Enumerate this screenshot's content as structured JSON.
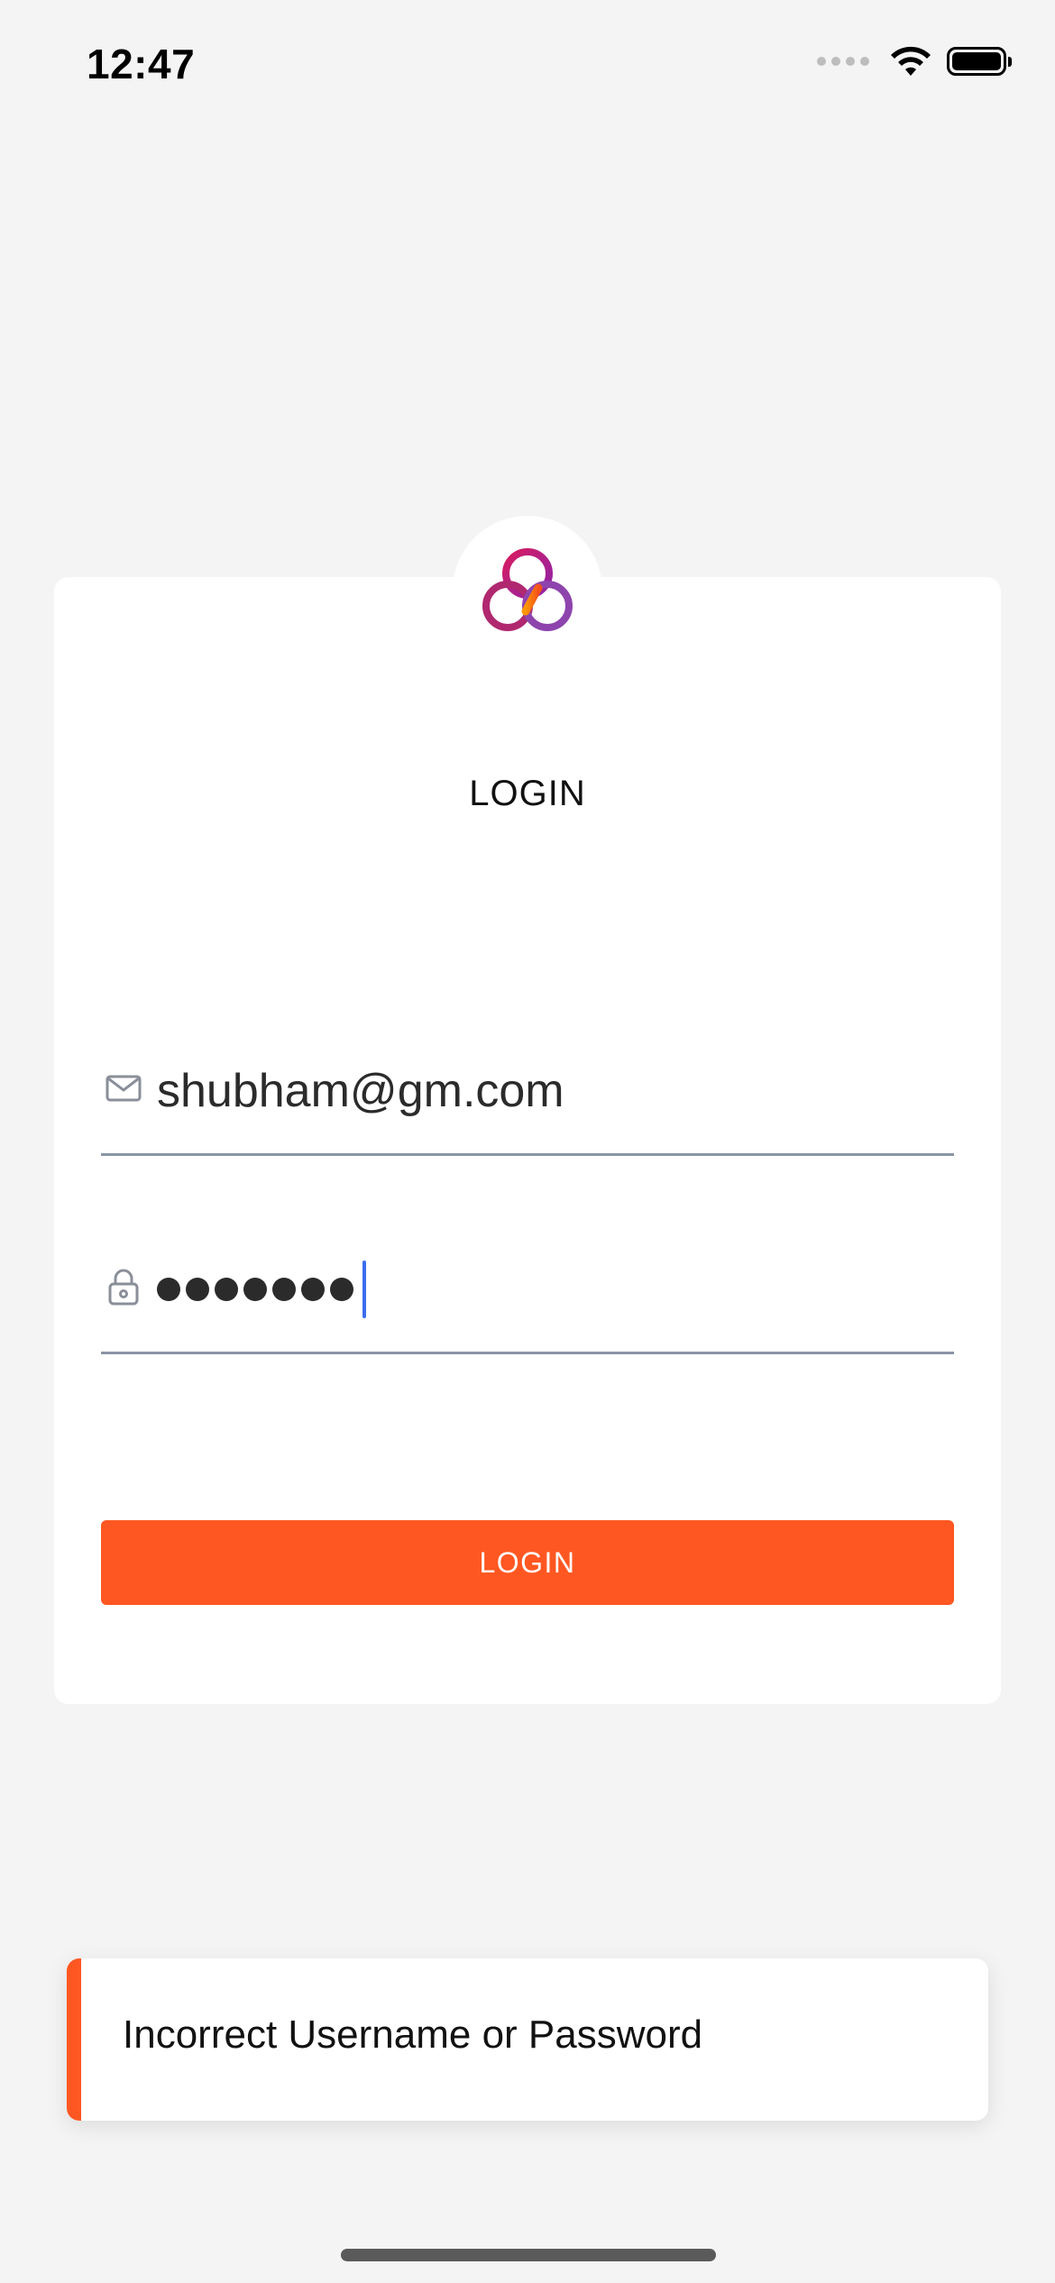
{
  "status_bar": {
    "time": "12:47",
    "icons": [
      "cellular-signal-icon",
      "wifi-icon",
      "battery-icon"
    ]
  },
  "logo": {
    "icon": "trefoil-logo-icon",
    "colors": [
      "#c2185b",
      "#8e44ad",
      "#ff9800"
    ]
  },
  "login_card": {
    "title": "LOGIN",
    "email": {
      "icon": "mail-icon",
      "value": "shubham@gm.com"
    },
    "password": {
      "icon": "lock-icon",
      "masked_length": 7
    },
    "button_label": "LOGIN"
  },
  "toast": {
    "message": "Incorrect Username or Password",
    "accent_color": "#ff5722"
  },
  "colors": {
    "background": "#f4f4f4",
    "accent": "#ff5722",
    "caret": "#3c6df0"
  }
}
